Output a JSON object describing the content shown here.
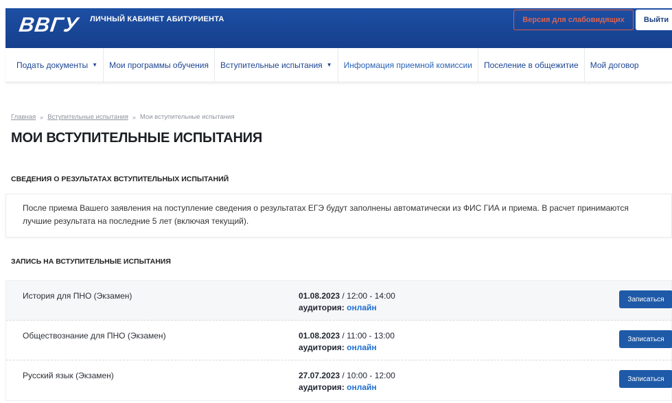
{
  "header": {
    "logo_text": "ВВГУ",
    "title": "ЛИЧНЫЙ КАБИНЕТ АБИТУРИЕНТА",
    "vision_button": "Версия для слабовидящих",
    "logout_button": "Выйти",
    "colors": {
      "background": "#1d4fa3",
      "vision_border": "#e05a4a"
    }
  },
  "nav": {
    "items": [
      {
        "label": "Подать документы",
        "caret": "▼"
      },
      {
        "label": "Мои программы обучения"
      },
      {
        "label": "Вступительные испытания",
        "caret": "▼"
      },
      {
        "label": "Информация приемной комиссии"
      },
      {
        "label": "Поселение в общежитие"
      },
      {
        "label": "Мой договор"
      }
    ]
  },
  "breadcrumb": {
    "items": [
      "Главная",
      "Вступительные испытания",
      "Мои вступительные испытания"
    ],
    "separator": "»"
  },
  "page": {
    "title": "МОИ ВСТУПИТЕЛЬНЫЕ ИСПЫТАНИЯ"
  },
  "results_section": {
    "title": "СВЕДЕНИЯ О РЕЗУЛЬТАТАХ ВСТУПИТЕЛЬНЫХ ИСПЫТАНИЙ",
    "text": "После приема Вашего заявления на поступление сведения о результатах ЕГЭ будут заполнены автоматически из ФИС ГИА и приема. В расчет принимаются лучшие результата на последние 5 лет (включая текущий)."
  },
  "signup_section": {
    "title": "ЗАПИСЬ НА ВСТУПИТЕЛЬНЫЕ ИСПЫТАНИЯ",
    "room_label": "аудитория:",
    "exams": [
      {
        "name": "История для ПНО (Экзамен)",
        "date": "01.08.2023",
        "time": " / 12:00 - 14:00",
        "room": "онлайн",
        "button": "Записаться"
      },
      {
        "name": "Обществознание для ПНО (Экзамен)",
        "date": "01.08.2023",
        "time": " / 11:00 - 13:00",
        "room": "онлайн",
        "button": "Записаться"
      },
      {
        "name": "Русский язык (Экзамен)",
        "date": "27.07.2023",
        "time": " / 10:00 - 12:00",
        "room": "онлайн",
        "button": "Записаться"
      }
    ]
  }
}
